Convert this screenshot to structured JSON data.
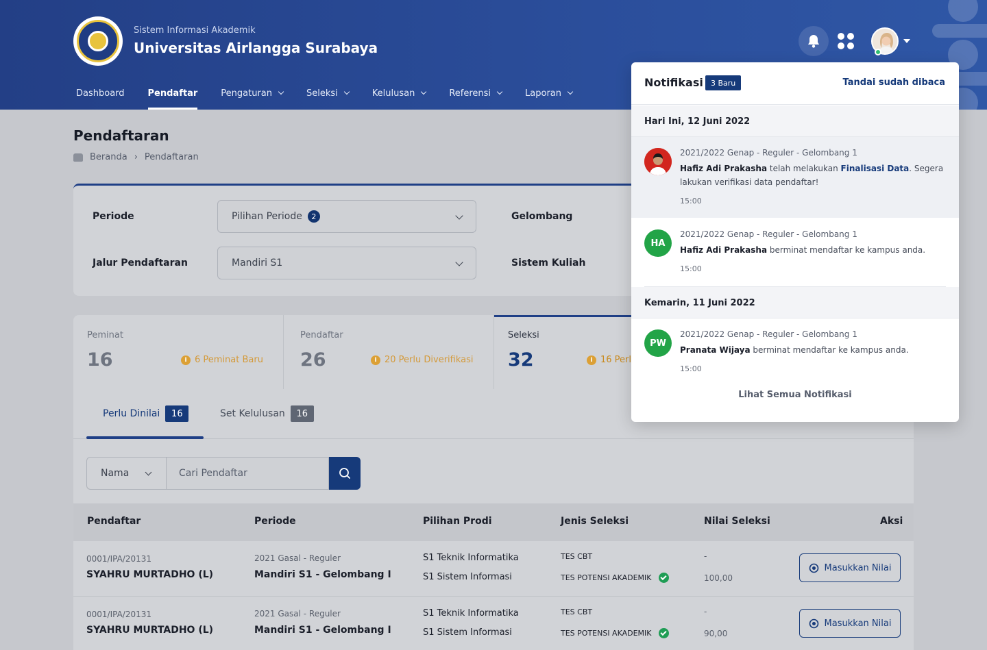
{
  "header": {
    "subtitle": "Sistem Informasi Akademik",
    "title": "Universitas Airlangga Surabaya",
    "nav": [
      {
        "label": "Dashboard"
      },
      {
        "label": "Pendaftar"
      },
      {
        "label": "Pengaturan"
      },
      {
        "label": "Seleksi"
      },
      {
        "label": "Kelulusan"
      },
      {
        "label": "Referensi"
      },
      {
        "label": "Laporan"
      }
    ],
    "icons": {
      "notification": "bell-icon",
      "apps": "grid-icon",
      "avatar": "user-avatar"
    }
  },
  "page": {
    "title": "Pendaftaran",
    "breadcrumb": [
      "Beranda",
      "Pendaftaran"
    ]
  },
  "filters": {
    "periode_label": "Periode",
    "periode_value": "Pilihan Periode",
    "periode_count": "2",
    "gelombang_label": "Gelombang",
    "jalur_label": "Jalur Pendaftaran",
    "jalur_value": "Mandiri S1",
    "sistem_label": "Sistem Kuliah"
  },
  "stats": [
    {
      "label": "Peminat",
      "value": "16",
      "note": "6 Peminat Baru"
    },
    {
      "label": "Pendaftar",
      "value": "26",
      "note": "20 Perlu Diverifikasi"
    },
    {
      "label": "Seleksi",
      "value": "32",
      "note": "16 Perl"
    }
  ],
  "tabs": [
    {
      "label": "Perlu Dinilai",
      "count": "16"
    },
    {
      "label": "Set Kelulusan",
      "count": "16"
    }
  ],
  "search": {
    "field": "Nama",
    "placeholder": "Cari Pendaftar"
  },
  "table": {
    "headers": [
      "Pendaftar",
      "Periode",
      "Pilihan Prodi",
      "Jenis Seleksi",
      "Nilai Seleksi",
      "Aksi"
    ],
    "rows": [
      {
        "id": "0001/IPA/20131",
        "name": "SYAHRU MURTADHO (L)",
        "period_sub": "2021 Gasal - Reguler",
        "period": "Mandiri S1 - Gelombang I",
        "prodi_1": "S1 Teknik Informatika",
        "prodi_2": "S1 Sistem Informasi",
        "seleksi_1": "TES CBT",
        "seleksi_2": "TES POTENSI AKADEMIK",
        "nilai_1": "-",
        "nilai_2": "100,00",
        "action": "Masukkan Nilai"
      },
      {
        "id": "0001/IPA/20131",
        "name": "SYAHRU MURTADHO (L)",
        "period_sub": "2021 Gasal - Reguler",
        "period": "Mandiri S1 - Gelombang I",
        "prodi_1": "S1 Teknik Informatika",
        "prodi_2": "S1 Sistem Informasi",
        "seleksi_1": "TES CBT",
        "seleksi_2": "TES POTENSI AKADEMIK",
        "nilai_1": "-",
        "nilai_2": "90,00",
        "action": "Masukkan Nilai"
      }
    ]
  },
  "notifications": {
    "title": "Notifikasi",
    "badge": "3 Baru",
    "mark_read": "Tandai sudah dibaca",
    "today_label": "Hari Ini, 12 Juni 2022",
    "yesterday_label": "Kemarin, 11 Juni 2022",
    "items": [
      {
        "meta": "2021/2022 Genap - Reguler - Gelombang 1",
        "name": "Hafiz Adi Prakasha",
        "text_a": " telah melakukan ",
        "link": "Finalisasi Data",
        "text_b": ". Segera lakukan verifikasi data pendaftar!",
        "time": "15:00",
        "initials": ""
      },
      {
        "meta": "2021/2022 Genap - Reguler - Gelombang 1",
        "name": "Hafiz Adi Prakasha",
        "text_a": " berminat mendaftar ke kampus anda.",
        "time": "15:00",
        "initials": "HA"
      },
      {
        "meta": "2021/2022 Genap - Reguler - Gelombang 1",
        "name": "Pranata Wijaya",
        "text_a": " berminat mendaftar ke kampus anda.",
        "time": "15:00",
        "initials": "PW"
      }
    ],
    "footer": "Lihat Semua Notifikasi"
  },
  "colors": {
    "primary": "#163a7a",
    "header": "#2b4e9b",
    "success": "#1f9d55",
    "warning": "#dca035",
    "avatar_green": "#22a447"
  }
}
